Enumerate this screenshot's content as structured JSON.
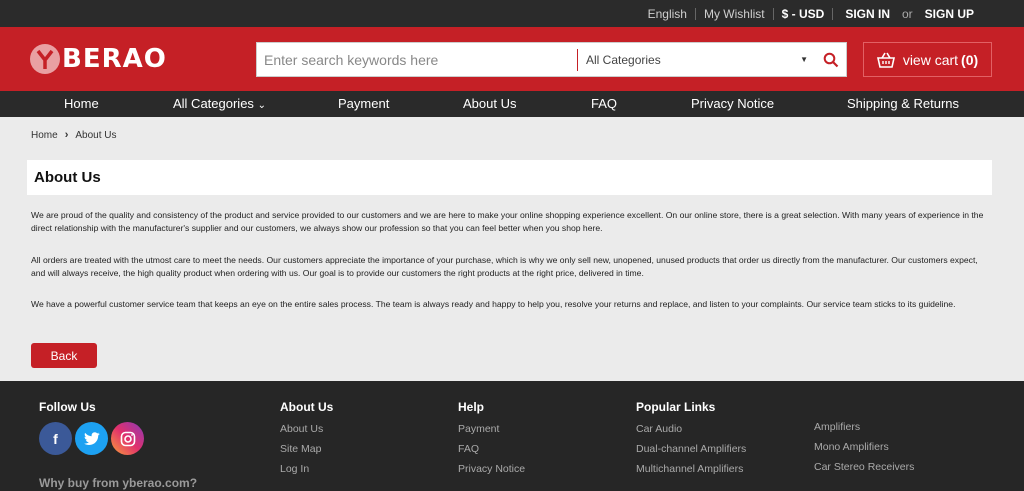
{
  "topbar": {
    "language": "English",
    "wishlist": "My Wishlist",
    "currency": "$ - USD",
    "sign_in": "SIGN IN",
    "or": "or",
    "sign_up": "SIGN UP"
  },
  "header": {
    "logo": "BERAO",
    "logo_mark": "Y",
    "search_placeholder": "Enter search keywords here",
    "category_selected": "All Categories",
    "cart_label": "view cart",
    "cart_count": "(0)"
  },
  "nav": {
    "items": [
      "Home",
      "All Categories",
      "Payment",
      "About Us",
      "FAQ",
      "Privacy Notice",
      "Shipping & Returns"
    ]
  },
  "breadcrumb": {
    "home": "Home",
    "current": "About Us"
  },
  "content": {
    "title": "About Us",
    "paragraphs": [
      "We are proud of the quality and consistency of the product and service provided to our customers and we are here to make your online shopping experience excellent. On our online store, there is a great selection. With many years of experience in the direct relationship with the manufacturer's supplier and our customers, we always show our profession so that you can feel better when you shop here.",
      "All orders are treated with the utmost care to meet the needs. Our customers appreciate the importance of your purchase, which is why we only sell new, unopened, unused products that order us directly from the manufacturer. Our customers expect, and will always receive, the high quality product when ordering with us. Our goal is to provide our customers the right products at the right price, delivered in time.",
      "We have a powerful customer service team that keeps an eye on the entire sales process. The team is always ready and happy to help you, resolve your returns and replace, and listen to your complaints. Our service team sticks to its guideline."
    ],
    "back_label": "Back"
  },
  "footer": {
    "follow_us": "Follow Us",
    "why_buy": "Why buy from yberao.com?",
    "about": {
      "heading": "About Us",
      "links": [
        "About Us",
        "Site Map",
        "Log In"
      ]
    },
    "help": {
      "heading": "Help",
      "links": [
        "Payment",
        "FAQ",
        "Privacy Notice"
      ]
    },
    "popular": {
      "heading": "Popular Links",
      "col1": [
        "Car Audio",
        "Dual-channel Amplifiers",
        "Multichannel Amplifiers"
      ],
      "col2": [
        "Amplifiers",
        "Mono Amplifiers",
        "Car Stereo Receivers"
      ]
    },
    "social_icons": [
      "facebook-icon",
      "twitter-icon",
      "instagram-icon"
    ]
  },
  "colors": {
    "brand_red": "#c52026",
    "dark": "#2a2a2a",
    "background": "#ebebeb"
  }
}
